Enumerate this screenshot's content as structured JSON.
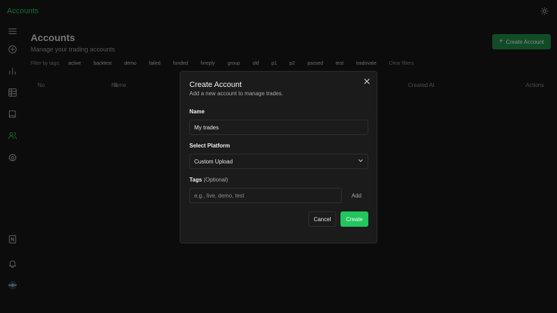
{
  "app": {
    "title": "Accounts",
    "accent": "#22c55e",
    "background": "#161616"
  },
  "topbar": {
    "theme_icon": "sun-icon"
  },
  "sidebar": {
    "items": [
      {
        "name": "menu-icon",
        "active": false
      },
      {
        "name": "add-circle-icon",
        "active": false
      },
      {
        "name": "bar-chart-icon",
        "active": false
      },
      {
        "name": "table-icon",
        "active": false
      },
      {
        "name": "book-icon",
        "active": false
      },
      {
        "name": "users-icon",
        "active": true
      },
      {
        "name": "gear-icon",
        "active": false
      }
    ],
    "bottom": [
      {
        "name": "notion-icon"
      },
      {
        "name": "bell-icon"
      },
      {
        "name": "avatar"
      }
    ]
  },
  "page": {
    "title": "Accounts",
    "subtitle": "Manage your trading accounts",
    "create_button": "Create Account",
    "filters_label": "Filter by tags:",
    "tags": [
      "active",
      "backtest",
      "demo",
      "failed",
      "funded",
      "fxreply",
      "group",
      "old",
      "p1",
      "p2",
      "passed",
      "test",
      "tradovate"
    ],
    "clear_filters": "Clear filters",
    "columns": {
      "no": "No",
      "name": "Name",
      "created_at": "Created At",
      "actions": "Actions"
    }
  },
  "modal": {
    "title": "Create Account",
    "description": "Add a new account to manage trades.",
    "name_label": "Name",
    "name_value": "My trades",
    "platform_label": "Select Platform",
    "platform_value": "Custom Upload",
    "tags_label": "Tags",
    "tags_optional": "(Optional)",
    "tags_placeholder": "e.g., live, demo, test",
    "add_label": "Add",
    "cancel_label": "Cancel",
    "create_label": "Create"
  }
}
